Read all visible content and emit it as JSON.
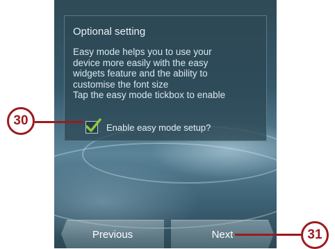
{
  "dialog": {
    "title": "Optional setting",
    "body_lines": [
      "Easy mode helps you to use your",
      "device more easily with the easy",
      "widgets feature and the ability to",
      "customise the font size",
      "Tap the easy mode tickbox to enable"
    ],
    "checkbox_label": "Enable easy mode setup?",
    "checkbox_checked": true
  },
  "navigation": {
    "previous_label": "Previous",
    "next_label": "Next"
  },
  "callouts": [
    {
      "number": "30"
    },
    {
      "number": "31"
    }
  ],
  "colors": {
    "callout": "#9a1b1f",
    "check": "#8dc63f"
  },
  "icons": {
    "checkmark": "checkmark-icon",
    "previous": "chevron-left-icon",
    "next": "chevron-right-icon"
  }
}
